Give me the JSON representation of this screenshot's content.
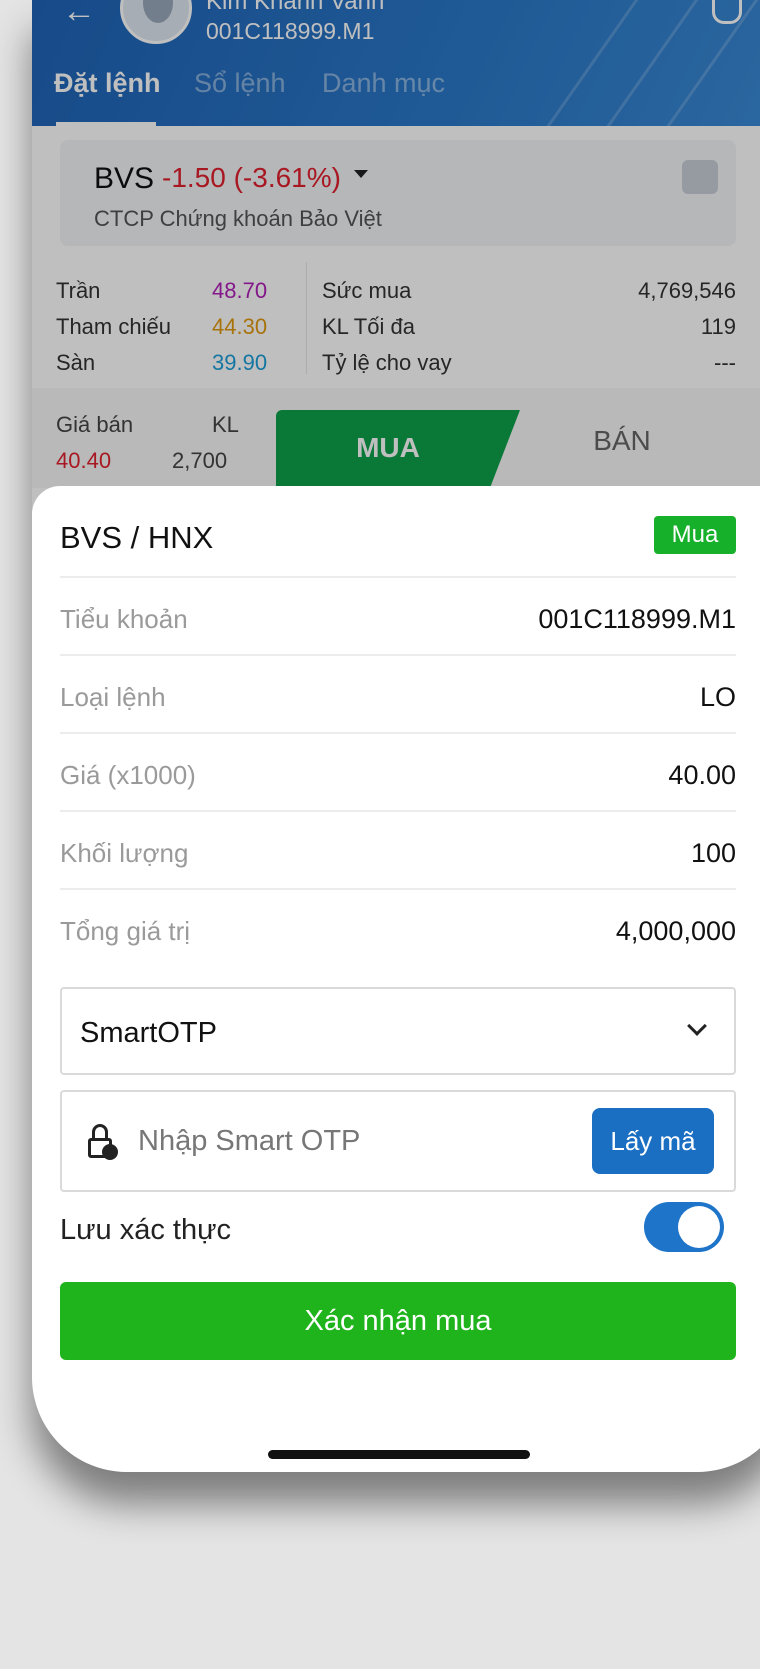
{
  "header": {
    "user_name": "Kim Khánh Vanh",
    "account": "001C118999.M1",
    "tabs": [
      {
        "label": "Đặt lệnh",
        "active": true
      },
      {
        "label": "Sổ lệnh",
        "active": false
      },
      {
        "label": "Danh mục",
        "active": false
      }
    ]
  },
  "stock": {
    "symbol": "BVS",
    "change": "-1.50 (-3.61%)",
    "company": "CTCP Chứng khoán Bảo Việt"
  },
  "prices": {
    "ceiling_label": "Trần",
    "ceiling": "48.70",
    "ref_label": "Tham chiếu",
    "ref": "44.30",
    "floor_label": "Sàn",
    "floor": "39.90",
    "power_label": "Sức mua",
    "power": "4,769,546",
    "maxvol_label": "KL Tối đa",
    "maxvol": "119",
    "margin_label": "Tỷ lệ cho vay",
    "margin": "---"
  },
  "orderbook": {
    "ask_label": "Giá bán",
    "vol_label": "KL",
    "ask_price": "40.40",
    "ask_vol": "2,700",
    "buy_tab": "MUA",
    "sell_tab": "BÁN"
  },
  "sheet": {
    "title": "BVS / HNX",
    "side_badge": "Mua",
    "rows": [
      {
        "label": "Tiểu khoản",
        "value": "001C118999.M1"
      },
      {
        "label": "Loại lệnh",
        "value": "LO"
      },
      {
        "label": "Giá (x1000)",
        "value": "40.00"
      },
      {
        "label": "Khối lượng",
        "value": "100"
      },
      {
        "label": "Tổng giá trị",
        "value": "4,000,000"
      }
    ],
    "auth_method": "SmartOTP",
    "otp_placeholder": "Nhập Smart OTP",
    "get_code": "Lấy mã",
    "save_auth_label": "Lưu xác thực",
    "save_auth_on": true,
    "confirm": "Xác nhận mua"
  },
  "colors": {
    "header_blue": "#2a78c8",
    "buy_green": "#0ea14a",
    "confirm_green": "#1fb41b",
    "down_red": "#e0202e",
    "ceiling": "#b020b8",
    "ref": "#e09a10",
    "floor": "#1e9ed8"
  },
  "icons": [
    "back-arrow-icon",
    "bell-icon",
    "chart-icon",
    "lock-clock-icon",
    "chevron-down-icon"
  ]
}
